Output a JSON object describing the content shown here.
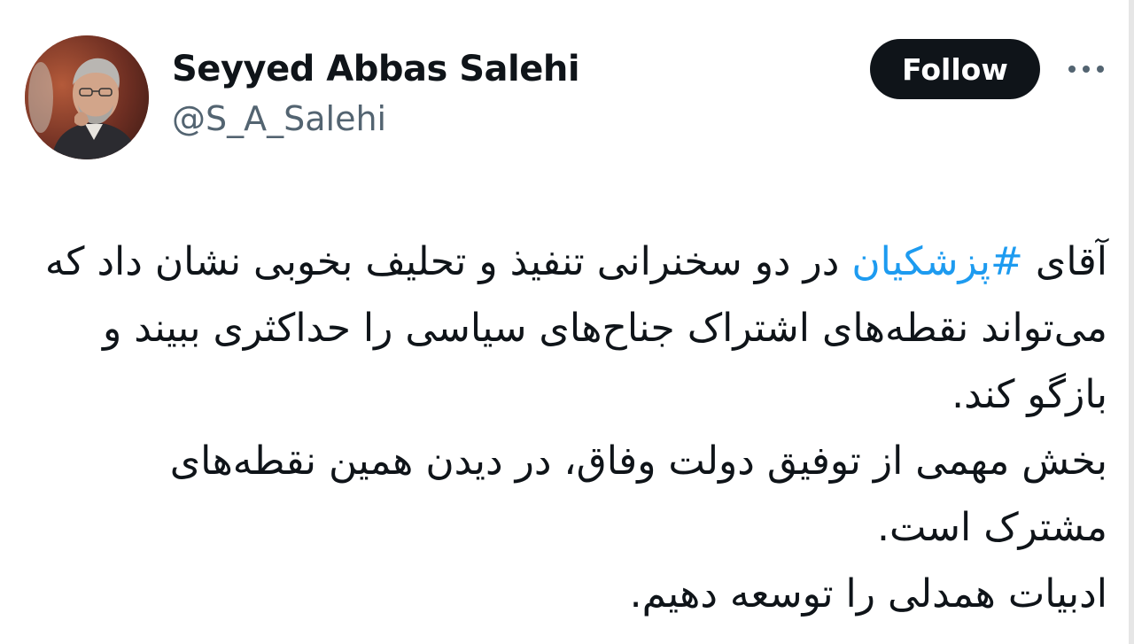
{
  "author": {
    "display_name": "Seyyed Abbas Salehi",
    "handle": "@S_A_Salehi",
    "avatar_icon": "profile-photo"
  },
  "actions": {
    "follow_label": "Follow",
    "more_icon": "more-horizontal-icon"
  },
  "tweet": {
    "line1_before": "آقای ",
    "hashtag": "#پزشکیان",
    "line1_after": " در دو سخنرانی تنفیذ و تحلیف بخوبی نشان داد که می‌تواند نقطه‌های اشتراک جناح‌های سیاسی را حداکثری ببیند و بازگو کند.",
    "paragraph2": "بخش مهمی از توفیق دولت وفاق، در دیدن همین نقطه‌های مشترک است.",
    "paragraph3": "ادبیات همدلی را توسعه دهیم."
  },
  "colors": {
    "text": "#0f1419",
    "secondary": "#536471",
    "link": "#1d9bf0",
    "button_bg": "#0f1419",
    "button_text": "#ffffff"
  }
}
